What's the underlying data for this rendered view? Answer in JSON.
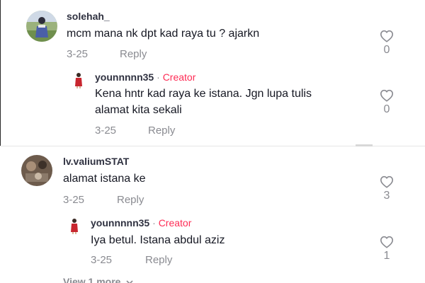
{
  "comments": [
    {
      "username": "solehah_",
      "text": "mcm mana nk dpt kad raya tu ? ajarkn",
      "date": "3-25",
      "reply_label": "Reply",
      "like_count": "0",
      "avatar_icon": "user-photo-avatar"
    },
    {
      "username": "younnnnn35",
      "separator": "·",
      "creator_label": "Creator",
      "text_line1": "Kena hntr kad raya ke istana. Jgn lupa tulis",
      "text_line2": "alamat kita sekali",
      "date": "3-25",
      "reply_label": "Reply",
      "like_count": "0",
      "avatar_icon": "creator-avatar"
    },
    {
      "username": "lv.valiumSTAT",
      "text": "alamat istana ke",
      "date": "3-25",
      "reply_label": "Reply",
      "like_count": "3",
      "avatar_icon": "user-photo-avatar"
    },
    {
      "username": "younnnnn35",
      "separator": "·",
      "creator_label": "Creator",
      "text": "Iya betul. Istana abdul aziz",
      "date": "3-25",
      "reply_label": "Reply",
      "like_count": "1",
      "avatar_icon": "creator-avatar"
    }
  ],
  "view_more": "View 1 more",
  "icons": {
    "like": "heart-outline-icon",
    "expand": "chevron-down-icon"
  },
  "colors": {
    "creator": "#fe2c55",
    "muted": "#8a8b91",
    "text": "#161823"
  }
}
